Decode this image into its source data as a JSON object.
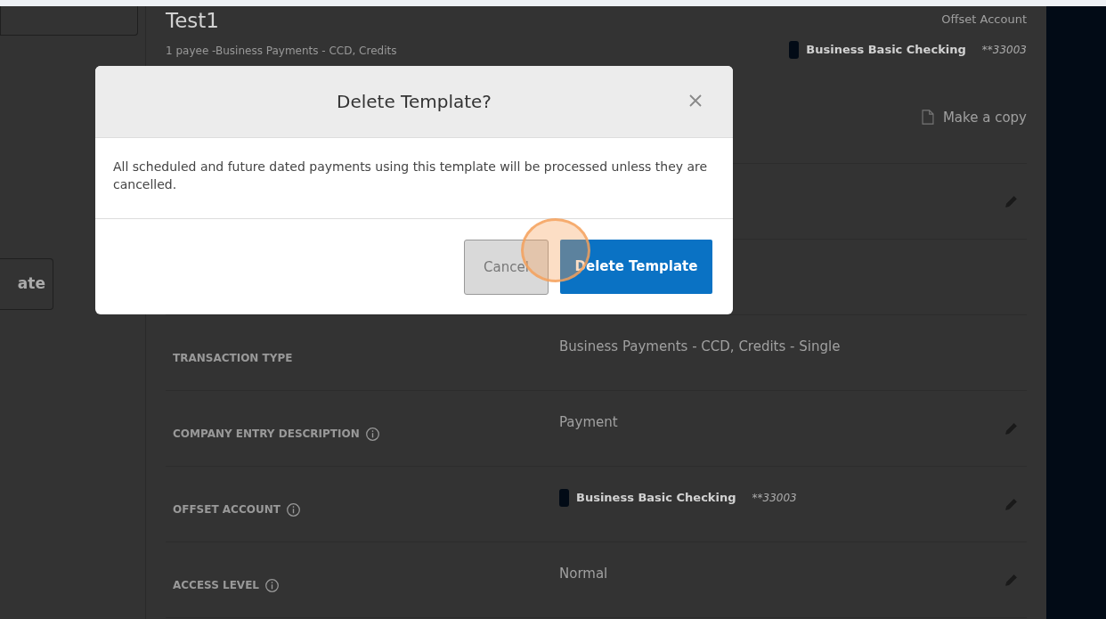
{
  "sidebar": {
    "button_label": "ate"
  },
  "template": {
    "title": "Test1",
    "subtitle": "1 payee -Business Payments - CCD, Credits",
    "offset_label": "Offset Account",
    "account_name": "Business Basic Checking",
    "account_mask": "**33003",
    "copy_link": "Make a copy"
  },
  "details": [
    {
      "kind": "text",
      "editable": true
    },
    {
      "kind": "text",
      "editable": false
    },
    {
      "label": "TRANSACTION TYPE",
      "value": "Business Payments - CCD, Credits - Single",
      "kind": "text",
      "editable": false
    },
    {
      "label": "COMPANY ENTRY DESCRIPTION",
      "info": true,
      "value": "Payment",
      "kind": "text",
      "editable": true
    },
    {
      "label": "OFFSET ACCOUNT",
      "info": true,
      "value": "Business Basic Checking",
      "mask": "**33003",
      "kind": "account",
      "editable": true
    },
    {
      "label": "ACCESS LEVEL",
      "info": true,
      "value": "Normal",
      "kind": "text",
      "editable": true
    }
  ],
  "modal": {
    "title": "Delete Template?",
    "message": "All scheduled and future dated payments using this template will be processed unless they are cancelled.",
    "buttons": [
      {
        "label": "Cancel",
        "kind": "secondary"
      },
      {
        "label": "Delete Template",
        "kind": "primary"
      }
    ]
  }
}
